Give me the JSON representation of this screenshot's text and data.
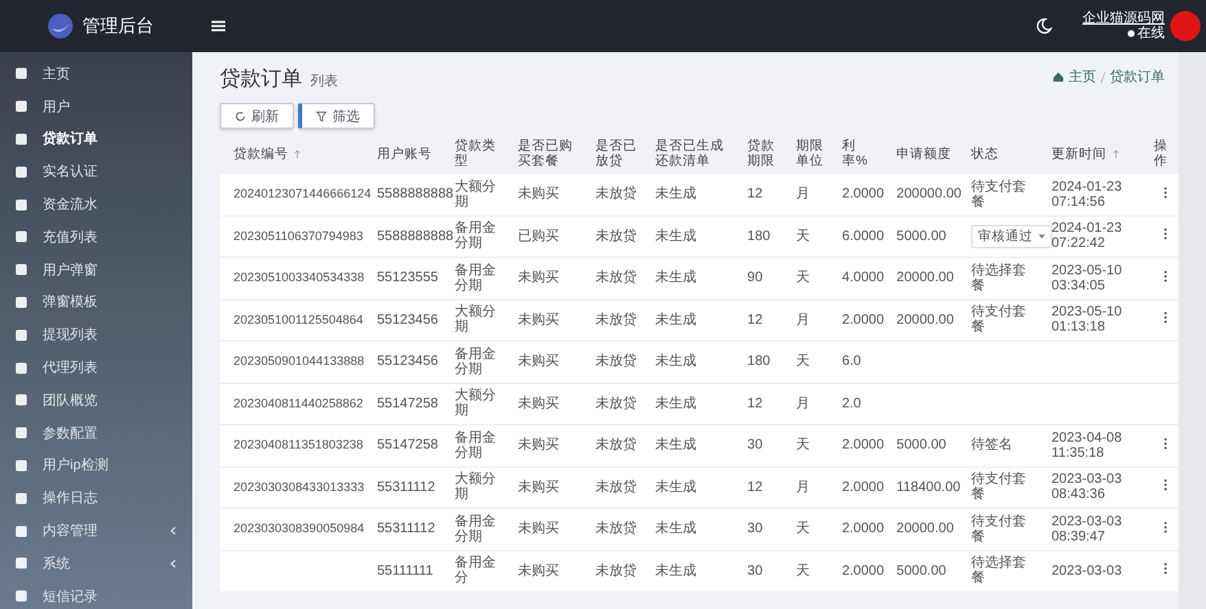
{
  "brand": {
    "title": "管理后台"
  },
  "header": {
    "user_name": "企业猫源码网",
    "status": "在线"
  },
  "sidebar": {
    "items": [
      {
        "label": "主页",
        "selected": false,
        "expandable": false
      },
      {
        "label": "用户",
        "selected": false,
        "expandable": false
      },
      {
        "label": "贷款订单",
        "selected": true,
        "expandable": false
      },
      {
        "label": "实名认证",
        "selected": false,
        "expandable": false
      },
      {
        "label": "资金流水",
        "selected": false,
        "expandable": false
      },
      {
        "label": "充值列表",
        "selected": false,
        "expandable": false
      },
      {
        "label": "用户弹窗",
        "selected": false,
        "expandable": false
      },
      {
        "label": "弹窗模板",
        "selected": false,
        "expandable": false
      },
      {
        "label": "提现列表",
        "selected": false,
        "expandable": false
      },
      {
        "label": "代理列表",
        "selected": false,
        "expandable": false
      },
      {
        "label": "团队概览",
        "selected": false,
        "expandable": false
      },
      {
        "label": "参数配置",
        "selected": false,
        "expandable": false
      },
      {
        "label": "用户ip检测",
        "selected": false,
        "expandable": false
      },
      {
        "label": "操作日志",
        "selected": false,
        "expandable": false
      },
      {
        "label": "内容管理",
        "selected": false,
        "expandable": true
      },
      {
        "label": "系统",
        "selected": false,
        "expandable": true
      },
      {
        "label": "短信记录",
        "selected": false,
        "expandable": false
      }
    ]
  },
  "page": {
    "title": "贷款订单",
    "subtitle": "列表",
    "breadcrumb": [
      "主页",
      "贷款订单"
    ]
  },
  "toolbar": {
    "buttons": [
      {
        "label": "刷新",
        "kind": "refresh"
      },
      {
        "label": "筛选",
        "kind": "filter"
      }
    ]
  },
  "table": {
    "columns": [
      {
        "label": "贷款编号",
        "sortable": true
      },
      {
        "label": "用户账号",
        "sortable": false
      },
      {
        "label": "贷款类型",
        "sortable": false
      },
      {
        "label": "是否已购买套餐",
        "sortable": false
      },
      {
        "label": "是否已放贷",
        "sortable": false
      },
      {
        "label": "是否已生成还款清单",
        "sortable": false
      },
      {
        "label": "贷款期限",
        "sortable": false
      },
      {
        "label": "期限单位",
        "sortable": false
      },
      {
        "label": "利率%",
        "sortable": false
      },
      {
        "label": "申请额度",
        "sortable": false
      },
      {
        "label": "状态",
        "sortable": false
      },
      {
        "label": "更新时间",
        "sortable": true
      },
      {
        "label": "操作",
        "sortable": false
      }
    ],
    "rows": [
      {
        "cells": [
          "20240123071446666124",
          "5588888888",
          "大额分期",
          "未购买",
          "未放贷",
          "未生成",
          "12",
          "月",
          "2.0000",
          "200000.00"
        ],
        "status": {
          "kind": "text",
          "label": "待支付套餐"
        },
        "time": "2024-01-23 07:14:56",
        "menu": true
      },
      {
        "cells": [
          "2023051106370794983",
          "5588888888",
          "备用金分期",
          "已购买",
          "未放贷",
          "未生成",
          "180",
          "天",
          "6.0000",
          "5000.00"
        ],
        "status": {
          "kind": "select",
          "label": "审核通过"
        },
        "time": "2024-01-23 07:22:42",
        "menu": true
      },
      {
        "cells": [
          "2023051003340534338",
          "55123555",
          "备用金分期",
          "未购买",
          "未放贷",
          "未生成",
          "90",
          "天",
          "4.0000",
          "20000.00"
        ],
        "status": {
          "kind": "text",
          "label": "待选择套餐"
        },
        "time": "2023-05-10 03:34:05",
        "menu": true
      },
      {
        "cells": [
          "2023051001125504864",
          "55123456",
          "大额分期",
          "未购买",
          "未放贷",
          "未生成",
          "12",
          "月",
          "2.0000",
          "20000.00"
        ],
        "status": {
          "kind": "text",
          "label": "待支付套餐"
        },
        "time": "2023-05-10 01:13:18",
        "menu": true
      },
      {
        "cells": [
          "2023050901044133888",
          "55123456",
          "备用金分期",
          "未购买",
          "未放贷",
          "未生成",
          "180",
          "天",
          "6.0",
          null
        ],
        "menu": false
      },
      {
        "cells": [
          "2023040811440258862",
          "55147258",
          "大额分期",
          "未购买",
          "未放贷",
          "未生成",
          "12",
          "月",
          "2.0",
          null
        ],
        "menu": false
      },
      {
        "cells": [
          "2023040811351803238",
          "55147258",
          "备用金分期",
          "未购买",
          "未放贷",
          "未生成",
          "30",
          "天",
          "2.0000",
          "5000.00"
        ],
        "status": {
          "kind": "text",
          "label": "待签名"
        },
        "time": "2023-04-08 11:35:18",
        "menu": true
      },
      {
        "cells": [
          "2023030308433013333",
          "55311112",
          "大额分期",
          "未购买",
          "未放贷",
          "未生成",
          "12",
          "月",
          "2.0000",
          "118400.00"
        ],
        "status": {
          "kind": "text",
          "label": "待支付套餐"
        },
        "time": "2023-03-03 08:43:36",
        "menu": true
      },
      {
        "cells": [
          "2023030308390050984",
          "55311112",
          "备用金分期",
          "未购买",
          "未放贷",
          "未生成",
          "30",
          "天",
          "2.0000",
          "20000.00"
        ],
        "status": {
          "kind": "text",
          "label": "待支付套餐"
        },
        "time": "2023-03-03 08:39:47",
        "menu": true
      },
      {
        "cells": [
          null,
          "55111111",
          "备用金分",
          "未购买",
          "未放贷",
          "未生成",
          "30",
          "天",
          "2.0000",
          "5000.00"
        ],
        "status": {
          "kind": "text",
          "label": "待选择套餐"
        },
        "time": "2023-03-03",
        "menu": true
      }
    ]
  }
}
